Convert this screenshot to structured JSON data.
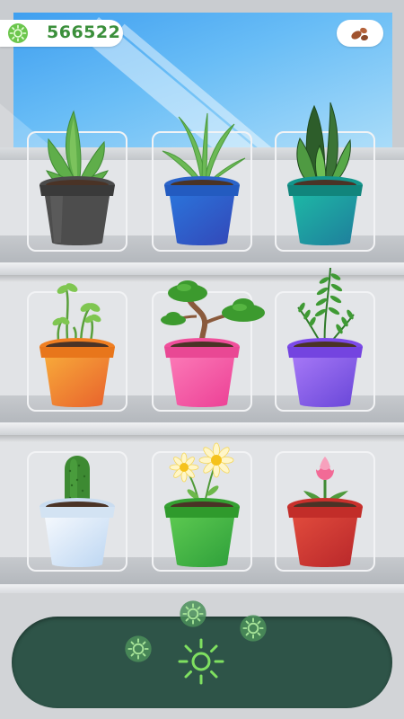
{
  "hud": {
    "currency_value": "566522",
    "currency_icon": "sun-coin-icon",
    "seed_icon": "seeds-icon"
  },
  "shelves": [
    {
      "plants": [
        {
          "name": "aloe-plant",
          "pot_color": "#4a4a4a"
        },
        {
          "name": "spider-plant",
          "pot_color": "#2d6fd6"
        },
        {
          "name": "snake-plant",
          "pot_color": "#1fa39a"
        }
      ]
    },
    {
      "plants": [
        {
          "name": "sprout-plant",
          "pot_color": "#f3892a"
        },
        {
          "name": "bonsai-plant",
          "pot_color": "#f55aa5"
        },
        {
          "name": "fern-plant",
          "pot_color": "#8a57f0"
        }
      ]
    },
    {
      "plants": [
        {
          "name": "cactus-plant",
          "pot_color": "#dbe9f8"
        },
        {
          "name": "daisy-plant",
          "pot_color": "#3fae3a"
        },
        {
          "name": "tulip-plant",
          "pot_color": "#d43b35"
        }
      ]
    }
  ],
  "collector": {
    "icon": "sun-collector-icon",
    "coin_icon": "sun-coin-icon",
    "accent": "#7fe060",
    "tray_color": "#2e5448"
  }
}
